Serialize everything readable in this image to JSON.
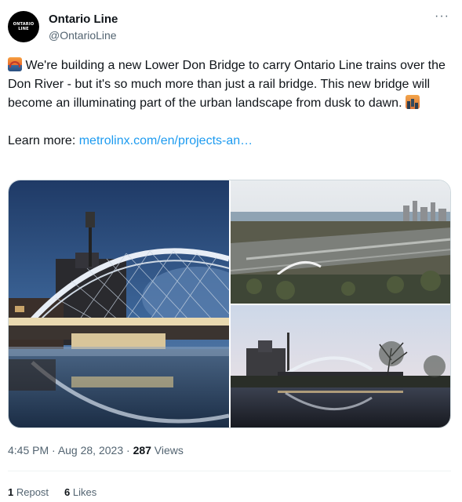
{
  "author": {
    "display_name": "Ontario Line",
    "handle": "@OntarioLine",
    "avatar_text_line1": "ONTARIO",
    "avatar_text_line2": "LINE"
  },
  "more_icon": "more-horizontal-icon",
  "tweet": {
    "text_main": " We're building a new Lower Don Bridge to carry Ontario Line trains over the Don River - but it's so much more than just a rail bridge. This new bridge will become an illuminating part of the urban landscape from dusk to dawn. ",
    "learn_more_label": "Learn more: ",
    "link_text": "metrolinx.com/en/projects-an…",
    "emoji_start": "bridge-at-night-emoji",
    "emoji_end": "cityscape-at-dusk-emoji"
  },
  "media": {
    "images": [
      {
        "name": "bridge-night-render"
      },
      {
        "name": "bridge-aerial-render"
      },
      {
        "name": "bridge-dusk-render"
      }
    ]
  },
  "meta": {
    "time": "4:45 PM",
    "separator1": " · ",
    "date": "Aug 28, 2023",
    "separator2": " · ",
    "views_count": "287",
    "views_label": " Views"
  },
  "stats": {
    "reposts_count": "1",
    "reposts_label": " Repost",
    "likes_count": "6",
    "likes_label": " Likes"
  },
  "colors": {
    "link": "#1d9bf0",
    "secondary_text": "#536471",
    "primary_text": "#0f1419"
  }
}
